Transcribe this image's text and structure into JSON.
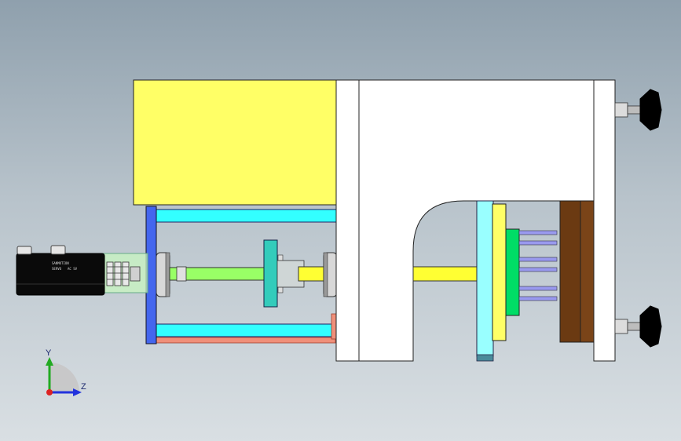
{
  "view": {
    "triad": {
      "y_label": "Y",
      "z_label": "Z"
    },
    "motor": {
      "label_line1": "SANMOTION",
      "label_line2a": "SERVO",
      "label_line2b": "AC SV"
    }
  },
  "colors": {
    "background_top": "#8fa0ad",
    "background_bottom": "#d9dfe3",
    "yellow_block": "#ffff66",
    "white_frame": "#ffffff",
    "cyan_rod": "#33ffff",
    "blue_plate": "#4466ee",
    "salmon_base": "#f0907a",
    "green_shaft": "#99ff66",
    "yellow_screw": "#ffff33",
    "teal_nut": "#33ccbb",
    "light_cyan_plate": "#99ffff",
    "mold_yellow": "#ffff66",
    "green_mold": "#00dd66",
    "brown_plate": "#6b3a12",
    "pins_purple": "#9999ee",
    "motor_black": "#0a0a0a",
    "knob_black": "#000000"
  }
}
